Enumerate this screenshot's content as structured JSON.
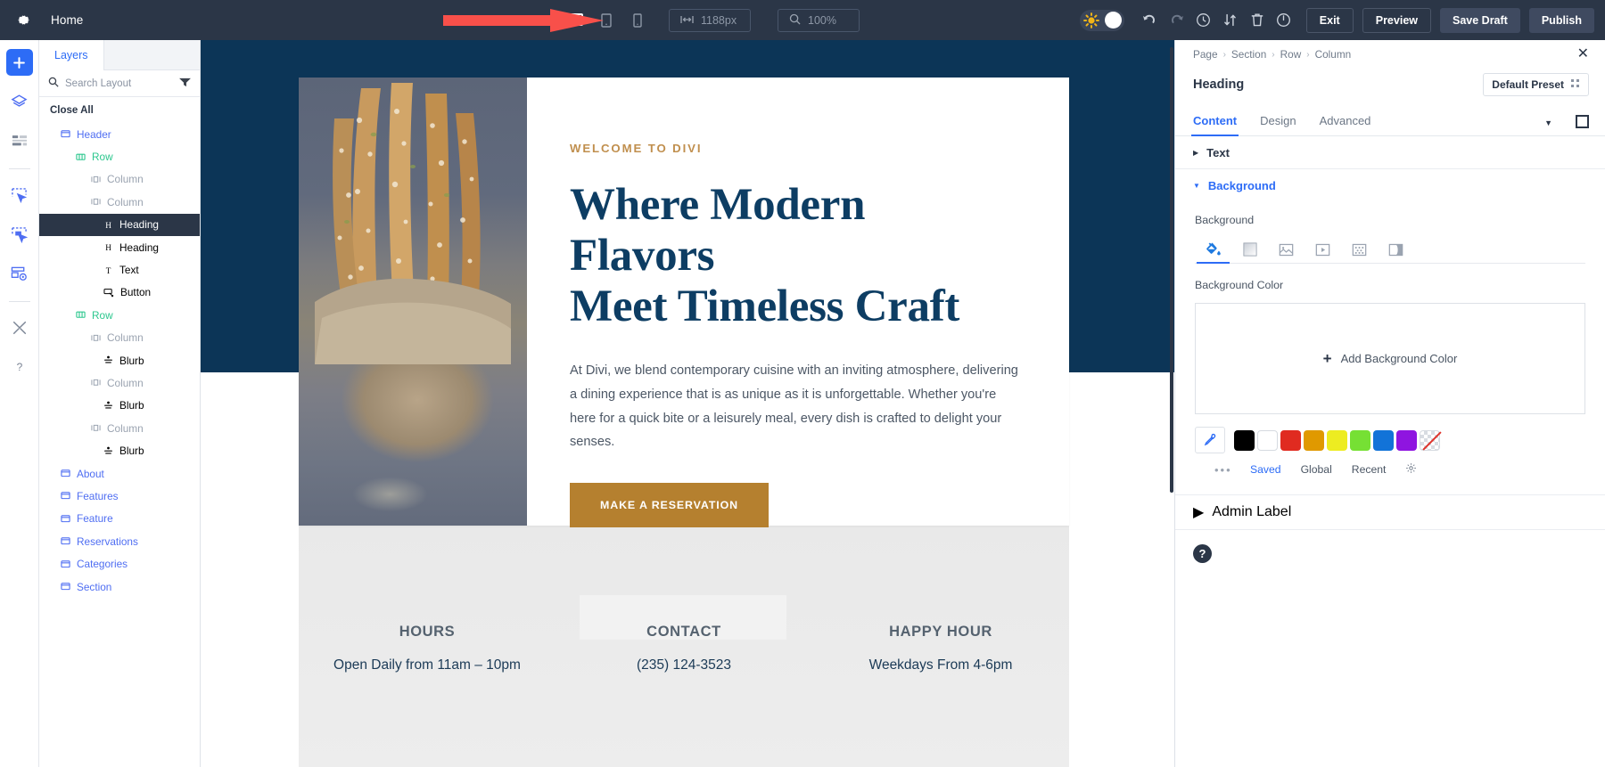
{
  "topbar": {
    "gear_icon": "gear-icon",
    "page_title": "Home",
    "devices": [
      {
        "name": "desktop",
        "icon": "desktop-icon",
        "active": true
      },
      {
        "name": "tablet",
        "icon": "tablet-icon",
        "active": false
      },
      {
        "name": "phone",
        "icon": "phone-icon",
        "active": false
      }
    ],
    "width_field": {
      "icon": "width-arrows-icon",
      "value": "1188px"
    },
    "zoom_field": {
      "icon": "magnifier-icon",
      "value": "100%"
    },
    "theme_toggle": {
      "icon": "sun-icon",
      "state": "light"
    },
    "icons": [
      {
        "name": "undo-icon"
      },
      {
        "name": "redo-icon"
      },
      {
        "name": "history-clock-icon"
      },
      {
        "name": "portability-icon"
      },
      {
        "name": "trash-icon"
      },
      {
        "name": "power-icon"
      }
    ],
    "exit_label": "Exit",
    "preview_label": "Preview",
    "save_draft_label": "Save Draft",
    "publish_label": "Publish"
  },
  "rail": {
    "items": [
      {
        "name": "add-icon",
        "primary": true
      },
      {
        "name": "layers-icon"
      },
      {
        "name": "wireframe-icon"
      },
      {
        "name": "click-select-icon"
      },
      {
        "name": "multiselect-icon"
      },
      {
        "name": "layout-preview-icon"
      },
      {
        "name": "tools-icon"
      },
      {
        "name": "help-question-icon"
      }
    ]
  },
  "layers_panel": {
    "tab_label": "Layers",
    "search_placeholder": "Search Layout",
    "search_icon": "search-icon",
    "filter_icon": "filter-icon",
    "close_all_label": "Close All",
    "items": [
      {
        "label": "Header",
        "type": "section",
        "indent": 0,
        "icon": "section-icon"
      },
      {
        "label": "Row",
        "type": "row",
        "indent": 1,
        "icon": "row-icon"
      },
      {
        "label": "Column",
        "type": "column",
        "indent": 2,
        "icon": "column-icon"
      },
      {
        "label": "Column",
        "type": "column",
        "indent": 2,
        "icon": "column-icon"
      },
      {
        "label": "Heading",
        "type": "module",
        "indent": 3,
        "icon": "heading-icon",
        "selected": true
      },
      {
        "label": "Heading",
        "type": "module",
        "indent": 3,
        "icon": "heading-icon"
      },
      {
        "label": "Text",
        "type": "module",
        "indent": 3,
        "icon": "text-icon"
      },
      {
        "label": "Button",
        "type": "module",
        "indent": 3,
        "icon": "button-icon"
      },
      {
        "label": "Row",
        "type": "row",
        "indent": 1,
        "icon": "row-icon"
      },
      {
        "label": "Column",
        "type": "column",
        "indent": 2,
        "icon": "column-icon"
      },
      {
        "label": "Blurb",
        "type": "module",
        "indent": 3,
        "icon": "blurb-icon"
      },
      {
        "label": "Column",
        "type": "column",
        "indent": 2,
        "icon": "column-icon"
      },
      {
        "label": "Blurb",
        "type": "module",
        "indent": 3,
        "icon": "blurb-icon"
      },
      {
        "label": "Column",
        "type": "column",
        "indent": 2,
        "icon": "column-icon"
      },
      {
        "label": "Blurb",
        "type": "module",
        "indent": 3,
        "icon": "blurb-icon"
      },
      {
        "label": "About",
        "type": "section",
        "indent": 0,
        "icon": "section-icon"
      },
      {
        "label": "Features",
        "type": "section",
        "indent": 0,
        "icon": "section-icon"
      },
      {
        "label": "Feature",
        "type": "section",
        "indent": 0,
        "icon": "section-icon"
      },
      {
        "label": "Reservations",
        "type": "section",
        "indent": 0,
        "icon": "section-icon"
      },
      {
        "label": "Categories",
        "type": "section",
        "indent": 0,
        "icon": "section-icon"
      },
      {
        "label": "Section",
        "type": "section",
        "indent": 0,
        "icon": "section-icon"
      }
    ]
  },
  "canvas": {
    "hero": {
      "eyebrow": "WELCOME TO DIVI",
      "heading_line1": "Where Modern Flavors",
      "heading_line2": "Meet Timeless Craft",
      "paragraph": "At Divi, we blend contemporary cuisine with an inviting atmosphere, delivering a dining experience that is as unique as it is unforgettable. Whether you're here for a quick bite or a leisurely meal, every dish is crafted to delight your senses.",
      "button_label": "MAKE A RESERVATION",
      "image_alt": "breadsticks-in-paper-bag-photo",
      "background_color": "#0c3557",
      "accent_color": "#c08f4e",
      "heading_color": "#0d3d63",
      "button_color": "#b5802f"
    },
    "info_strip": [
      {
        "title": "HOURS",
        "value": "Open Daily from 11am – 10pm"
      },
      {
        "title": "CONTACT",
        "value": "(235) 124-3523"
      },
      {
        "title": "HAPPY HOUR",
        "value": "Weekdays From 4-6pm"
      }
    ]
  },
  "settings_panel": {
    "breadcrumb": [
      "Page",
      "Section",
      "Row",
      "Column"
    ],
    "close_icon": "close-icon",
    "module_title": "Heading",
    "preset_label": "Default Preset",
    "preset_icon": "preset-icon",
    "tabs": [
      {
        "label": "Content",
        "active": true
      },
      {
        "label": "Design",
        "active": false
      },
      {
        "label": "Advanced",
        "active": false
      }
    ],
    "caret_icon": "chevron-down-icon",
    "expand_icon": "expand-square-icon",
    "sections": [
      {
        "label": "Text",
        "open": false
      },
      {
        "label": "Background",
        "open": true
      },
      {
        "label": "Admin Label",
        "open": false
      }
    ],
    "background": {
      "field_label": "Background",
      "types": [
        {
          "name": "background-color-icon",
          "active": true
        },
        {
          "name": "background-gradient-icon",
          "active": false
        },
        {
          "name": "background-image-icon",
          "active": false
        },
        {
          "name": "background-video-icon",
          "active": false
        },
        {
          "name": "background-pattern-icon",
          "active": false
        },
        {
          "name": "background-mask-icon",
          "active": false
        }
      ],
      "color_label": "Background Color",
      "add_color_label": "Add Background Color",
      "picker_icon": "eyedropper-icon",
      "swatches": [
        "#000000",
        "#ffffff",
        "#e02b20",
        "#e09900",
        "#edec21",
        "#76e034",
        "#1273d8",
        "#8f15e0",
        "none"
      ],
      "more_icon": "more-dots-icon",
      "meta": [
        {
          "label": "Saved",
          "active": true
        },
        {
          "label": "Global",
          "active": false
        },
        {
          "label": "Recent",
          "active": false
        }
      ],
      "settings_icon": "gear-small-icon"
    },
    "help_icon": "help-question-icon"
  }
}
